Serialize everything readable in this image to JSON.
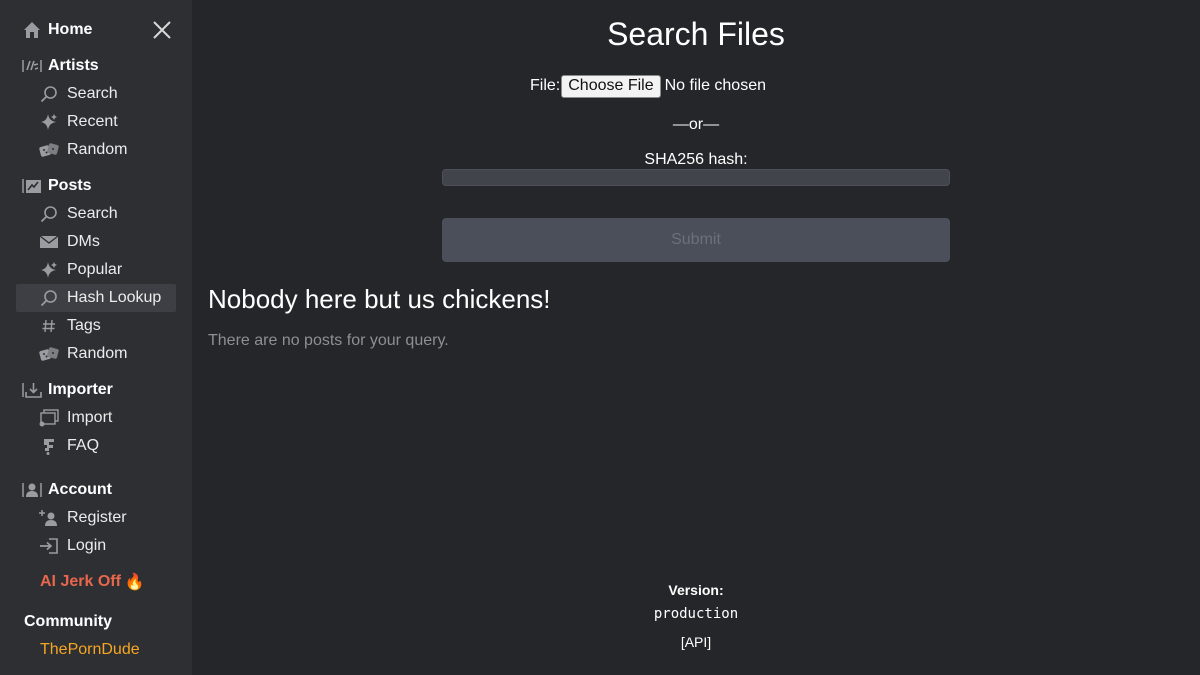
{
  "sidebar": {
    "home": {
      "label": "Home",
      "icon": "home-icon"
    },
    "close_icon": "close-icon",
    "artists": {
      "label": "Artists",
      "items": [
        {
          "label": "Search",
          "icon": "search-icon"
        },
        {
          "label": "Recent",
          "icon": "sparkle-icon"
        },
        {
          "label": "Random",
          "icon": "dice-icon"
        }
      ]
    },
    "posts": {
      "label": "Posts",
      "items": [
        {
          "label": "Search",
          "icon": "search-icon"
        },
        {
          "label": "DMs",
          "icon": "mail-icon"
        },
        {
          "label": "Popular",
          "icon": "sparkle-icon"
        },
        {
          "label": "Hash Lookup",
          "icon": "search-icon",
          "active": true
        },
        {
          "label": "Tags",
          "icon": "hash-icon"
        },
        {
          "label": "Random",
          "icon": "dice-icon"
        }
      ]
    },
    "importer": {
      "label": "Importer",
      "items": [
        {
          "label": "Import",
          "icon": "import-icon"
        },
        {
          "label": "FAQ",
          "icon": "faq-icon"
        }
      ]
    },
    "account": {
      "label": "Account",
      "items": [
        {
          "label": "Register",
          "icon": "register-icon"
        },
        {
          "label": "Login",
          "icon": "login-icon"
        }
      ]
    },
    "promo": {
      "label": "AI Jerk Off",
      "emoji": "🔥",
      "color": "#e8674c"
    },
    "community": {
      "title": "Community",
      "link": "ThePornDude",
      "link_color": "#f5a623"
    }
  },
  "main": {
    "title": "Search Files",
    "file_label": "File:",
    "choose_file": "Choose File",
    "no_file": "No file chosen",
    "or": "—or—",
    "hash_label": "SHA256 hash:",
    "hash_value": "",
    "submit": "Submit",
    "empty_title": "Nobody here but us chickens!",
    "empty_subtitle": "There are no posts for your query."
  },
  "footer": {
    "version_label": "Version:",
    "version_value": "production",
    "api_link": "[API]"
  },
  "colors": {
    "background": "#252629",
    "sidebar": "#2d2f33",
    "active_item": "#3d3f45",
    "submit_bg": "#4a4f59"
  }
}
